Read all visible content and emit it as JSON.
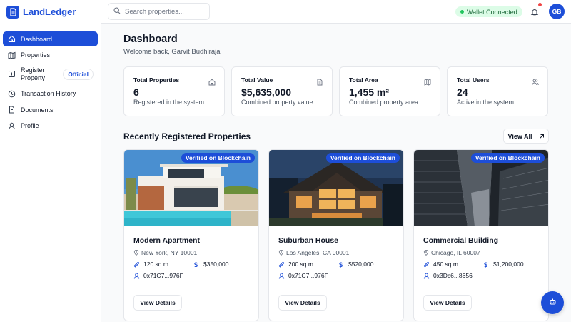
{
  "app": {
    "name": "LandLedger",
    "accent": "#1d4ed8"
  },
  "sidebar": {
    "items": [
      {
        "label": "Dashboard",
        "icon": "home-icon",
        "active": true
      },
      {
        "label": "Properties",
        "icon": "map-icon"
      },
      {
        "label": "Register Property",
        "icon": "plus-square-icon",
        "badge": "Official"
      },
      {
        "label": "Transaction History",
        "icon": "clock-icon"
      },
      {
        "label": "Documents",
        "icon": "document-icon"
      },
      {
        "label": "Profile",
        "icon": "user-icon"
      }
    ]
  },
  "topbar": {
    "search_placeholder": "Search properties...",
    "wallet_status": "Wallet Connected",
    "avatar_initials": "GB"
  },
  "main": {
    "title": "Dashboard",
    "welcome": "Welcome back, Garvit Budhiraja",
    "stats": [
      {
        "label": "Total Properties",
        "value": "6",
        "sub": "Registered in the system",
        "icon": "home-icon"
      },
      {
        "label": "Total Value",
        "value": "$5,635,000",
        "sub": "Combined property value",
        "icon": "document-icon"
      },
      {
        "label": "Total Area",
        "value": "1,455 m²",
        "sub": "Combined property area",
        "icon": "map-icon"
      },
      {
        "label": "Total Users",
        "value": "24",
        "sub": "Active in the system",
        "icon": "users-icon"
      }
    ],
    "section_title": "Recently Registered Properties",
    "view_all": "View All",
    "properties": [
      {
        "name": "Modern Apartment",
        "location": "New York, NY 10001",
        "area": "120 sq.m",
        "price": "$350,000",
        "owner": "0x71C7...976F",
        "badge": "Verified on Blockchain",
        "button": "View Details"
      },
      {
        "name": "Suburban House",
        "location": "Los Angeles, CA 90001",
        "area": "200 sq.m",
        "price": "$520,000",
        "owner": "0x71C7...976F",
        "badge": "Verified on Blockchain",
        "button": "View Details"
      },
      {
        "name": "Commercial Building",
        "location": "Chicago, IL 60007",
        "area": "450 sq.m",
        "price": "$1,200,000",
        "owner": "0x3Dc6...8656",
        "badge": "Verified on Blockchain",
        "button": "View Details"
      }
    ]
  }
}
